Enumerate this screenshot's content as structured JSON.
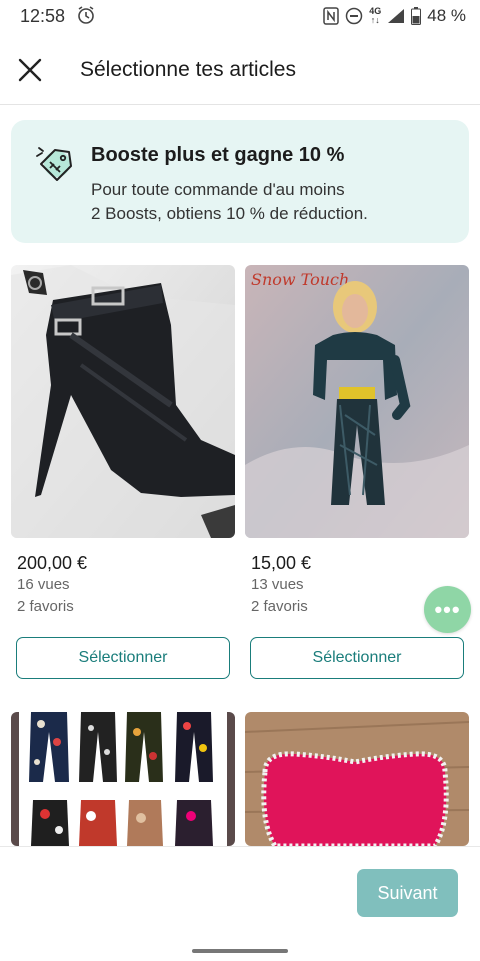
{
  "status_bar": {
    "time": "12:58",
    "network": "4G",
    "battery": "48 %"
  },
  "header": {
    "title": "Sélectionne tes articles"
  },
  "promo": {
    "title": "Booste plus et gagne 10 %",
    "line1": "Pour toute commande d'au moins",
    "line2": "2 Boosts, obtiens 10 % de réduction."
  },
  "items": [
    {
      "price": "200,00 €",
      "views": "16 vues",
      "favorites": "2 favoris",
      "button": "Sélectionner"
    },
    {
      "price": "15,00 €",
      "views": "13 vues",
      "favorites": "2 favoris",
      "button": "Sélectionner",
      "image_text": "Snow Touch"
    }
  ],
  "footer": {
    "next_label": "Suivant"
  },
  "colors": {
    "accent": "#1a7d7b",
    "promo_bg": "#e6f5f3",
    "next_button": "#80bfbd",
    "fab": "#8fd6a6"
  },
  "icons": {
    "close": "close-icon",
    "promo": "boost-tag-icon",
    "fab": "more-dots-icon",
    "alarm": "alarm-icon"
  }
}
